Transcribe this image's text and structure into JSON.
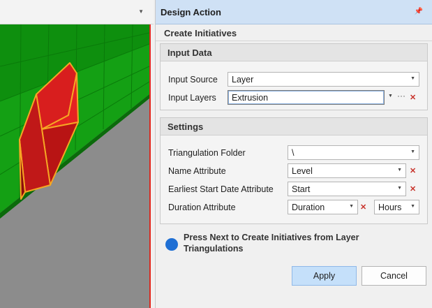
{
  "panel": {
    "title": "Design Action",
    "section_title": "Create Initiatives"
  },
  "input_data": {
    "header": "Input Data",
    "input_source": {
      "label": "Input Source",
      "value": "Layer"
    },
    "input_layers": {
      "label": "Input Layers",
      "value": "Extrusion"
    }
  },
  "settings": {
    "header": "Settings",
    "triangulation_folder": {
      "label": "Triangulation Folder",
      "value": "\\"
    },
    "name_attribute": {
      "label": "Name Attribute",
      "value": "Level"
    },
    "earliest_start": {
      "label": "Earliest Start Date Attribute",
      "value": "Start"
    },
    "duration": {
      "label": "Duration Attribute",
      "value": "Duration",
      "unit": "Hours"
    }
  },
  "status": {
    "message": "Press Next to Create Initiatives from Layer Triangulations",
    "indicator_color": "#1f6fd4"
  },
  "buttons": {
    "apply": "Apply",
    "cancel": "Cancel"
  },
  "icons": {
    "pin": "pin-icon",
    "dropdown": "chevron-down-icon",
    "clear": "close-icon",
    "more": "ellipsis-icon"
  },
  "colors": {
    "titlebar": "#cfe1f5",
    "viewport_border": "#e0281e",
    "apply_button": "#c5e0fa"
  }
}
